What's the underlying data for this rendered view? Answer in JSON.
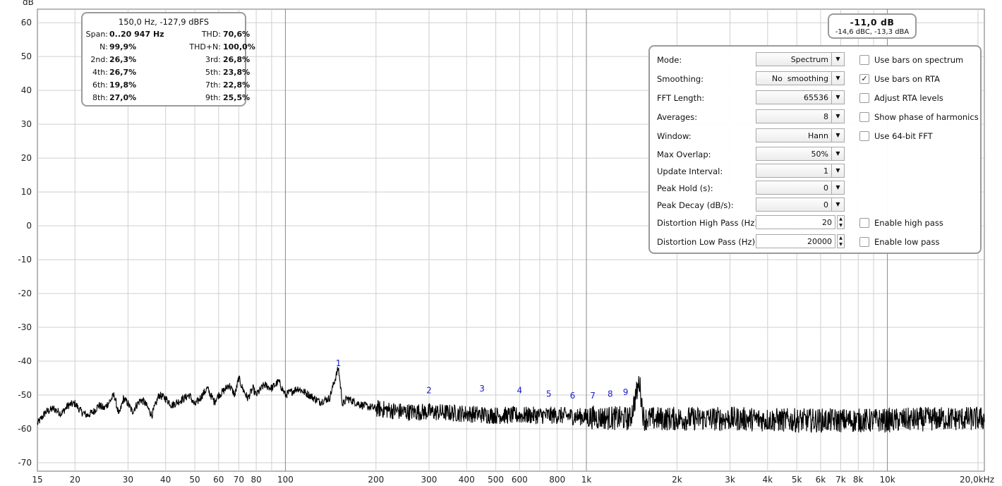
{
  "chart_data": {
    "type": "line",
    "ylabel": "dB",
    "y_ticks": [
      60,
      50,
      40,
      30,
      20,
      10,
      0,
      -10,
      -20,
      -30,
      -40,
      -50,
      -60,
      -70
    ],
    "ylim": [
      -72.5,
      64
    ],
    "x_scale": "log",
    "xlim": [
      15,
      21000
    ],
    "x_ticks": [
      {
        "v": 15,
        "t": "15"
      },
      {
        "v": 20,
        "t": "20"
      },
      {
        "v": 30,
        "t": "30"
      },
      {
        "v": 40,
        "t": "40"
      },
      {
        "v": 50,
        "t": "50"
      },
      {
        "v": 60,
        "t": "60"
      },
      {
        "v": 70,
        "t": "70"
      },
      {
        "v": 80,
        "t": "80"
      },
      {
        "v": 100,
        "t": "100"
      },
      {
        "v": 200,
        "t": "200"
      },
      {
        "v": 300,
        "t": "300"
      },
      {
        "v": 400,
        "t": "400"
      },
      {
        "v": 500,
        "t": "500"
      },
      {
        "v": 600,
        "t": "600"
      },
      {
        "v": 800,
        "t": "800"
      },
      {
        "v": 1000,
        "t": "1k"
      },
      {
        "v": 2000,
        "t": "2k"
      },
      {
        "v": 3000,
        "t": "3k"
      },
      {
        "v": 4000,
        "t": "4k"
      },
      {
        "v": 5000,
        "t": "5k"
      },
      {
        "v": 6000,
        "t": "6k"
      },
      {
        "v": 7000,
        "t": "7k"
      },
      {
        "v": 8000,
        "t": "8k"
      },
      {
        "v": 10000,
        "t": "10k"
      },
      {
        "v": 20000,
        "t": "20,0kHz"
      }
    ],
    "series": [
      {
        "color": "#000000",
        "values": [
          [
            15,
            -58.5
          ],
          [
            16,
            -55
          ],
          [
            17,
            -54
          ],
          [
            18,
            -55.5
          ],
          [
            19,
            -53
          ],
          [
            20,
            -52.5
          ],
          [
            21,
            -55
          ],
          [
            22,
            -56
          ],
          [
            23,
            -55
          ],
          [
            24,
            -53
          ],
          [
            25,
            -54
          ],
          [
            26,
            -52
          ],
          [
            27,
            -50
          ],
          [
            28,
            -56
          ],
          [
            29,
            -51
          ],
          [
            30,
            -52.5
          ],
          [
            31,
            -55
          ],
          [
            32,
            -53
          ],
          [
            33,
            -51.5
          ],
          [
            34,
            -52
          ],
          [
            35,
            -54
          ],
          [
            36,
            -56
          ],
          [
            37,
            -53
          ],
          [
            38,
            -50
          ],
          [
            40,
            -51
          ],
          [
            42,
            -53
          ],
          [
            44,
            -52
          ],
          [
            46,
            -51
          ],
          [
            48,
            -50
          ],
          [
            50,
            -53
          ],
          [
            52,
            -51
          ],
          [
            55,
            -48
          ],
          [
            58,
            -52
          ],
          [
            60,
            -50
          ],
          [
            62,
            -49
          ],
          [
            65,
            -47
          ],
          [
            68,
            -50
          ],
          [
            70,
            -45
          ],
          [
            72,
            -48
          ],
          [
            75,
            -51
          ],
          [
            78,
            -48
          ],
          [
            80,
            -50
          ],
          [
            85,
            -47
          ],
          [
            90,
            -48
          ],
          [
            95,
            -46
          ],
          [
            100,
            -50
          ],
          [
            110,
            -48
          ],
          [
            120,
            -50
          ],
          [
            130,
            -52
          ],
          [
            140,
            -51
          ],
          [
            150,
            -42
          ],
          [
            155,
            -53
          ],
          [
            160,
            -51
          ],
          [
            180,
            -53
          ],
          [
            200,
            -54
          ],
          [
            250,
            -55
          ],
          [
            300,
            -55
          ],
          [
            400,
            -55.5
          ],
          [
            500,
            -56
          ],
          [
            600,
            -56
          ],
          [
            800,
            -56
          ],
          [
            1000,
            -56.5
          ],
          [
            1400,
            -57
          ],
          [
            1500,
            -46
          ],
          [
            1550,
            -57
          ],
          [
            2000,
            -57
          ],
          [
            3000,
            -57
          ],
          [
            5000,
            -57.5
          ],
          [
            10000,
            -57.5
          ],
          [
            15000,
            -57
          ],
          [
            20000,
            -57
          ]
        ]
      }
    ],
    "harmonic_markers": [
      {
        "label": "1",
        "x": 150,
        "y": -41.5
      },
      {
        "label": "2",
        "x": 300,
        "y": -49.5
      },
      {
        "label": "3",
        "x": 450,
        "y": -49
      },
      {
        "label": "4",
        "x": 600,
        "y": -49.5
      },
      {
        "label": "5",
        "x": 750,
        "y": -50.5
      },
      {
        "label": "6",
        "x": 900,
        "y": -51
      },
      {
        "label": "7",
        "x": 1050,
        "y": -51
      },
      {
        "label": "8",
        "x": 1200,
        "y": -50.5
      },
      {
        "label": "9",
        "x": 1350,
        "y": -50
      }
    ]
  },
  "info": {
    "header": "150,0 Hz, -127,9 dBFS",
    "rows": [
      {
        "lk": "Span:",
        "lv": "0..20 947 Hz",
        "rk": "THD:",
        "rv": "70,6%"
      },
      {
        "lk": "N:",
        "lv": "99,9%",
        "rk": "THD+N:",
        "rv": "100,0%"
      },
      {
        "lk": "2nd:",
        "lv": "26,3%",
        "rk": "3rd:",
        "rv": "26,8%"
      },
      {
        "lk": "4th:",
        "lv": "26,7%",
        "rk": "5th:",
        "rv": "23,8%"
      },
      {
        "lk": "6th:",
        "lv": "19,8%",
        "rk": "7th:",
        "rv": "22,8%"
      },
      {
        "lk": "8th:",
        "lv": "27,0%",
        "rk": "9th:",
        "rv": "25,5%"
      }
    ]
  },
  "level": {
    "main": "-11,0 dB",
    "sub": "-14,6 dBC, -13,3 dBA"
  },
  "settings": {
    "mode": {
      "label": "Mode:",
      "value": "Spectrum"
    },
    "smoothing": {
      "label": "Smoothing:",
      "value": "No  smoothing"
    },
    "fft": {
      "label": "FFT Length:",
      "value": "65536"
    },
    "averages": {
      "label": "Averages:",
      "value": "8"
    },
    "window": {
      "label": "Window:",
      "value": "Hann"
    },
    "overlap": {
      "label": "Max Overlap:",
      "value": "50%"
    },
    "update": {
      "label": "Update Interval:",
      "value": "1"
    },
    "peakhold": {
      "label": "Peak Hold (s):",
      "value": "0"
    },
    "peakdecay": {
      "label": "Peak Decay (dB/s):",
      "value": "0"
    },
    "highpass": {
      "label": "Distortion High Pass (Hz):",
      "value": "20"
    },
    "lowpass": {
      "label": "Distortion Low Pass (Hz):",
      "value": "20000"
    },
    "checks": {
      "bars_spectrum": {
        "label": "Use bars on spectrum",
        "checked": false
      },
      "bars_rta": {
        "label": "Use bars on RTA",
        "checked": true
      },
      "adjust_rta": {
        "label": "Adjust RTA levels",
        "checked": false
      },
      "phase_harm": {
        "label": "Show phase of harmonics",
        "checked": false
      },
      "fft64": {
        "label": "Use 64-bit FFT",
        "checked": false
      },
      "enable_hp": {
        "label": "Enable high pass",
        "checked": false
      },
      "enable_lp": {
        "label": "Enable low pass",
        "checked": false
      }
    }
  }
}
